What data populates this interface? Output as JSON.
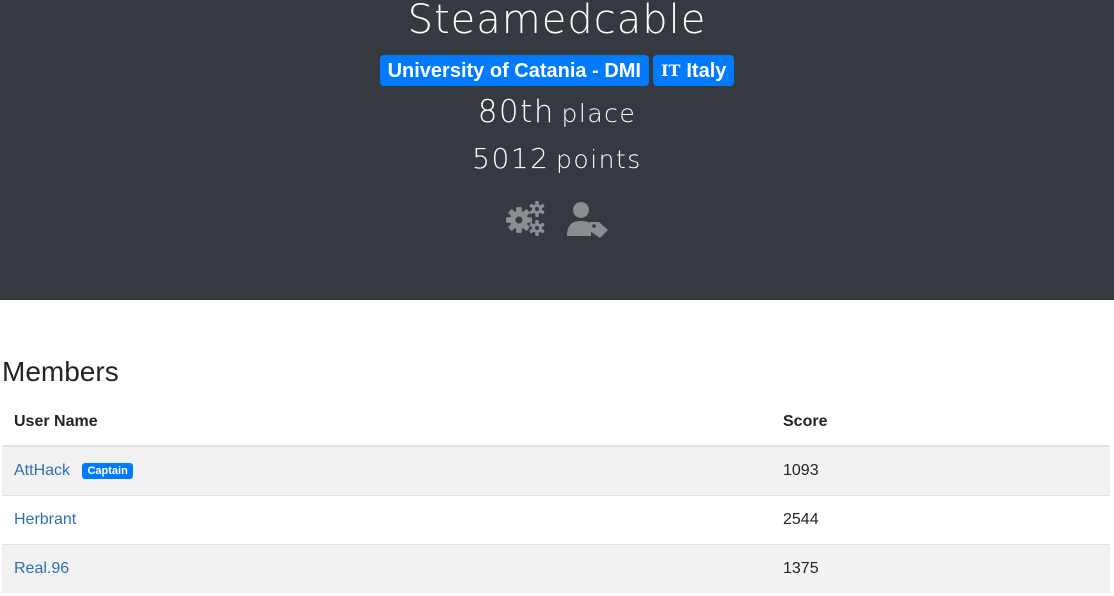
{
  "team": {
    "name": "Steamedcable",
    "affiliation": "University of Catania - DMI",
    "country_flag": "IT",
    "country": "Italy",
    "place_number": "80th",
    "place_label": "place",
    "points_number": "5012",
    "points_label": "points",
    "icons": [
      "cogs-icon",
      "user-tag-icon"
    ]
  },
  "members": {
    "title": "Members",
    "columns": [
      "User Name",
      "Score"
    ],
    "rows": [
      {
        "name": "AttHack",
        "badge": "Captain",
        "score": "1093"
      },
      {
        "name": "Herbrant",
        "badge": "",
        "score": "2544"
      },
      {
        "name": "Real.96",
        "badge": "",
        "score": "1375"
      }
    ]
  },
  "colors": {
    "header_bg": "#343a40",
    "badge_blue": "#007bff",
    "link": "#2f6fb3",
    "icon_gray": "#8a8d91",
    "row_stripe": "#f2f2f2"
  }
}
